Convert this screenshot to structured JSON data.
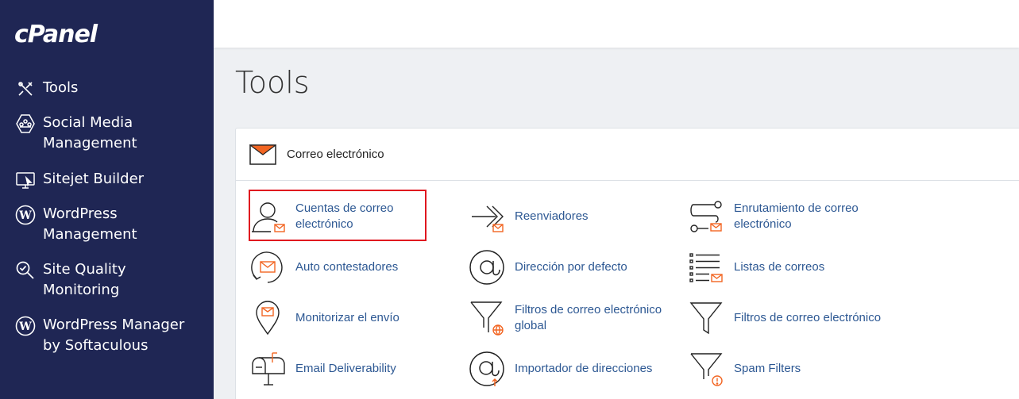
{
  "brand": {
    "logo": "cPanel"
  },
  "sidebar": {
    "items": [
      {
        "label": "Tools",
        "icon": "tools-icon"
      },
      {
        "label": "Social Media Management",
        "icon": "social-media-icon"
      },
      {
        "label": "Sitejet Builder",
        "icon": "sitejet-icon"
      },
      {
        "label": "WordPress Management",
        "icon": "wordpress-icon"
      },
      {
        "label": "Site Quality Monitoring",
        "icon": "site-quality-icon"
      },
      {
        "label": "WordPress Manager by Softaculous",
        "icon": "wordpress-icon"
      }
    ]
  },
  "page": {
    "title": "Tools"
  },
  "email_section": {
    "title": "Correo electrónico",
    "icon": "envelope-icon",
    "tools": [
      {
        "label": "Cuentas de correo electrónico",
        "icon": "email-accounts-icon"
      },
      {
        "label": "Reenviadores",
        "icon": "forwarders-icon"
      },
      {
        "label": "Enrutamiento de correo electrónico",
        "icon": "email-routing-icon"
      },
      {
        "label": "Auto contestadores",
        "icon": "autoresponders-icon"
      },
      {
        "label": "Dirección por defecto",
        "icon": "default-address-icon"
      },
      {
        "label": "Listas de correos",
        "icon": "mailing-lists-icon"
      },
      {
        "label": "Monitorizar el envío",
        "icon": "track-delivery-icon"
      },
      {
        "label": "Filtros de correo electrónico global",
        "icon": "global-filters-icon"
      },
      {
        "label": "Filtros de correo electrónico",
        "icon": "email-filters-icon"
      },
      {
        "label": "Email Deliverability",
        "icon": "email-deliverability-icon"
      },
      {
        "label": "Importador de direcciones",
        "icon": "address-importer-icon"
      },
      {
        "label": "Spam Filters",
        "icon": "spam-filters-icon"
      }
    ]
  },
  "colors": {
    "sidebar_bg": "#1f2654",
    "accent": "#f26522",
    "link": "#2d5893",
    "highlight": "#e0161f"
  }
}
